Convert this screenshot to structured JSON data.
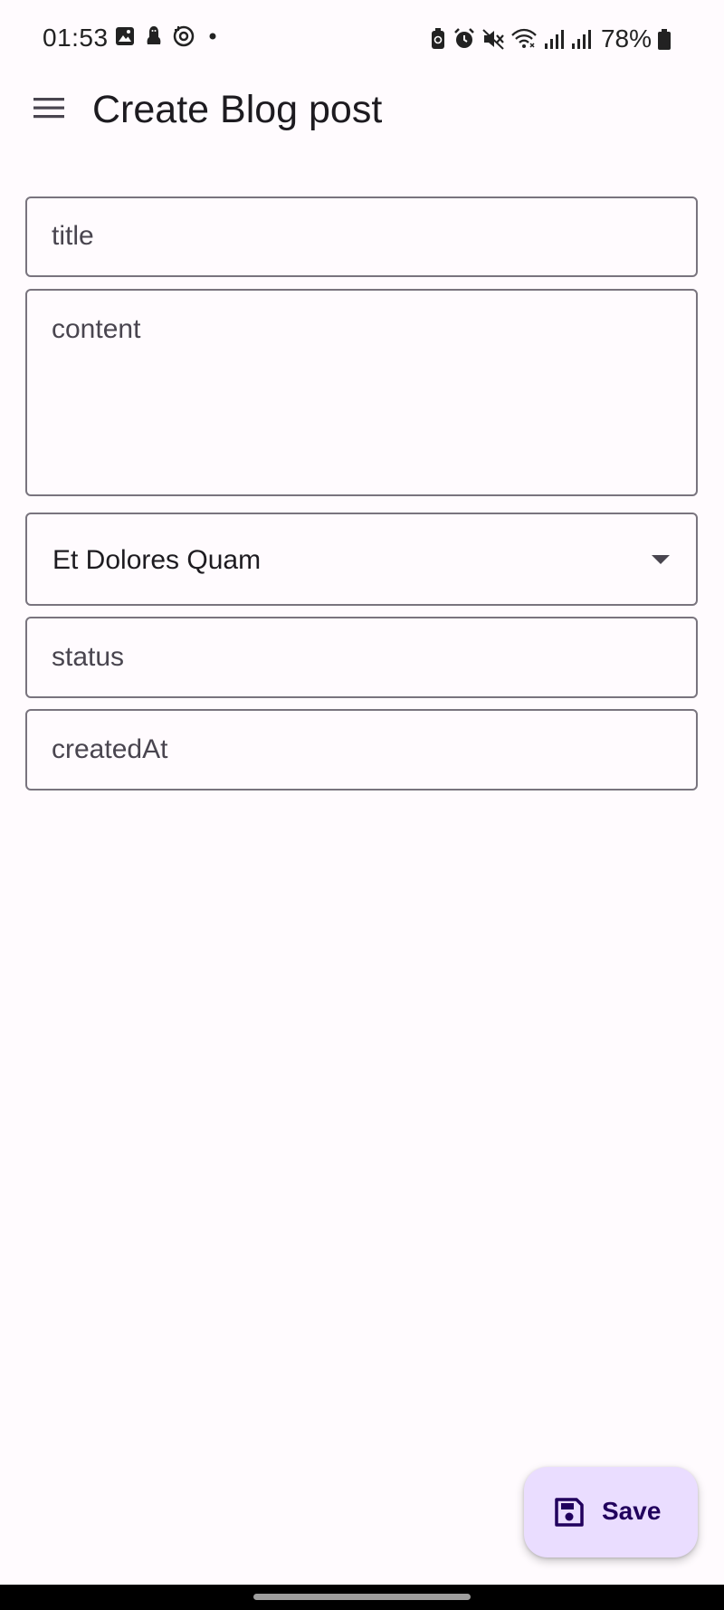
{
  "status_bar": {
    "time": "01:53",
    "battery_percent": "78%",
    "left_icons": [
      "image-icon",
      "android-icon",
      "sync-icon",
      "dot-icon"
    ],
    "right_icons": [
      "battery-saver-icon",
      "alarm-icon",
      "mute-icon",
      "wifi-icon",
      "signal-icon",
      "signal-icon-2",
      "battery-icon"
    ]
  },
  "app_bar": {
    "title": "Create Blog post",
    "menu_icon": "hamburger-menu-icon"
  },
  "form": {
    "title_placeholder": "title",
    "content_placeholder": "content",
    "blog_select_value": "Et Dolores Quam",
    "status_placeholder": "status",
    "created_at_placeholder": "createdAt"
  },
  "fab": {
    "label": "Save",
    "icon": "save-icon"
  },
  "colors": {
    "background": "#fffbfe",
    "outline": "#79747e",
    "fab_container": "#eaddff",
    "fab_content": "#21005d"
  }
}
